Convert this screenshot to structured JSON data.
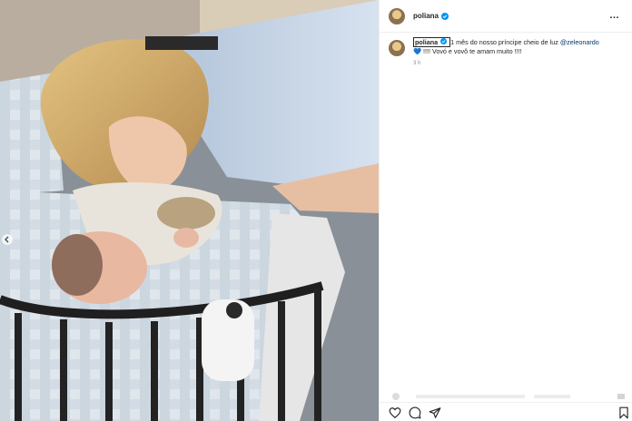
{
  "post": {
    "username": "poliana",
    "more_label": "…",
    "caption": {
      "username": "poliana",
      "text": "1 mês do nosso príncipe cheio de luz",
      "mention": "@zeleonardo",
      "line2_emoji": "💙",
      "line2_text": "!!!! Vovó e vovô te amam muito !!!!",
      "time": "3 h"
    }
  },
  "icons": [
    "verified-badge-icon",
    "heart-icon",
    "comment-icon",
    "share-icon",
    "bookmark-icon",
    "chevron-left-icon"
  ],
  "colors": {
    "verified": "#0095f6",
    "mention": "#00376b",
    "text": "#262626",
    "muted": "#8e8e8e"
  }
}
